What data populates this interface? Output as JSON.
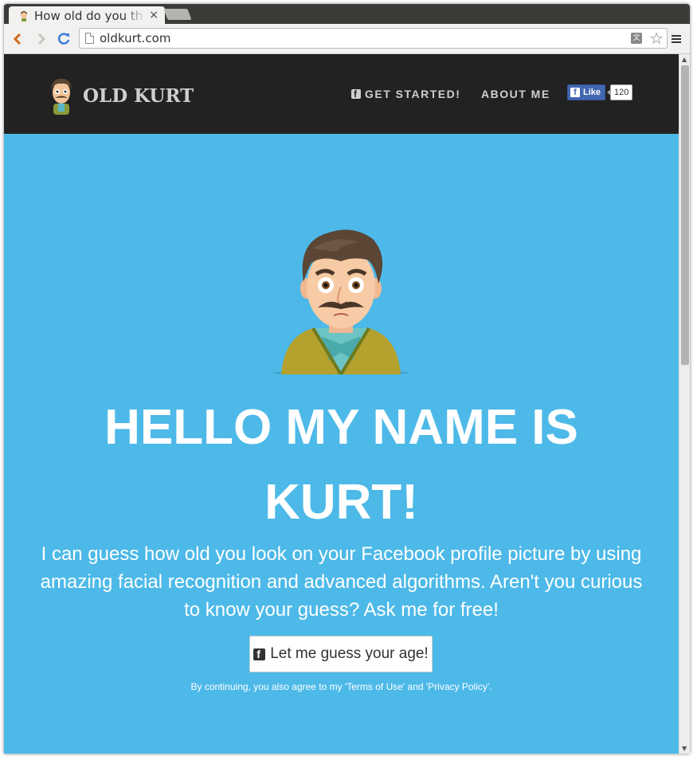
{
  "browser": {
    "tab_title": "How old do you th",
    "tab_close": "×",
    "url": "oldkurt.com",
    "translate_glyph": "文"
  },
  "nav": {
    "brand": "OLD KURT",
    "links": [
      {
        "label": "GET STARTED!"
      },
      {
        "label": "ABOUT ME"
      }
    ],
    "fb_like_label": "Like",
    "fb_like_count": "120"
  },
  "hero": {
    "title": "HELLO MY NAME IS KURT!",
    "description": "I can guess how old you look on your Facebook profile picture by using amazing facial recognition and advanced algorithms. Aren't you curious to know your guess? Ask me for free!",
    "cta_label": "Let me guess your age!",
    "terms": "By continuing, you also agree to my 'Terms of Use' and 'Privacy Policy'."
  },
  "colors": {
    "hero_bg": "#4db9e8",
    "nav_bg": "#222222",
    "nav_text": "#cfcfcf",
    "fb_blue": "#4267b2"
  },
  "icons": [
    "back-icon",
    "forward-icon",
    "reload-icon",
    "page-icon",
    "translate-icon",
    "star-icon",
    "menu-icon",
    "facebook-icon",
    "kurt-avatar"
  ]
}
